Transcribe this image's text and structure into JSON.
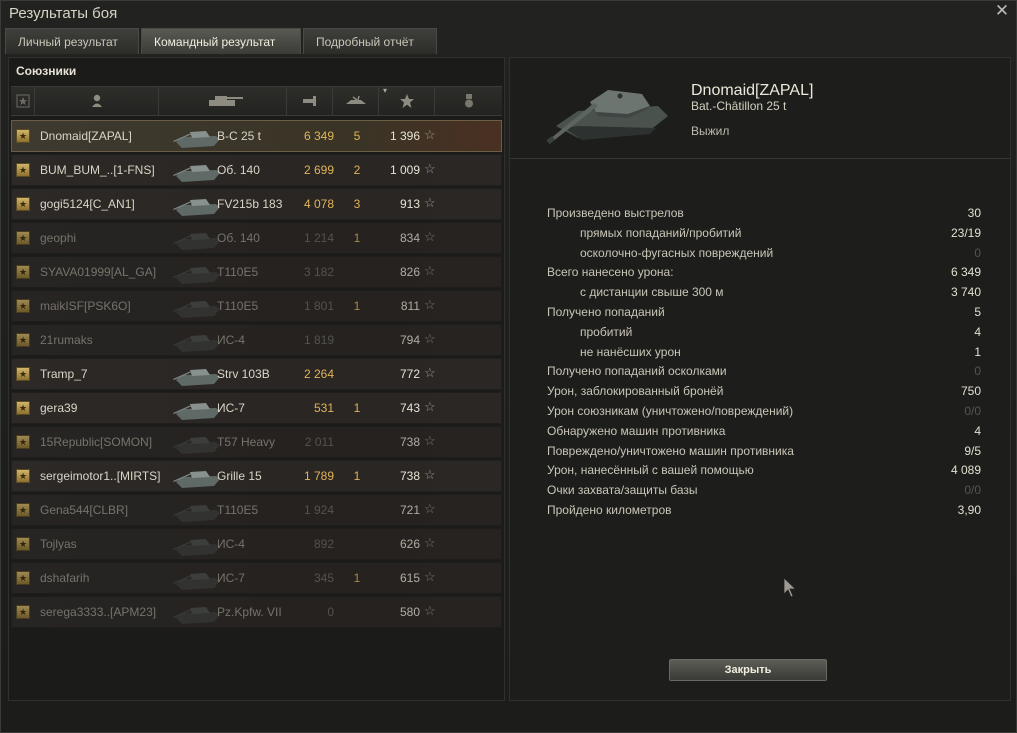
{
  "window": {
    "title": "Результаты боя"
  },
  "tabs": [
    {
      "label": "Личный результат"
    },
    {
      "label": "Командный результат"
    },
    {
      "label": "Подробный отчёт"
    }
  ],
  "allies": {
    "title": "Союзники",
    "rows": [
      {
        "player": "Dnomaid[ZAPAL]",
        "tank": "B-C 25 t",
        "damage": "6 349",
        "kills": "5",
        "xp": "1 396",
        "alive": true,
        "me": true
      },
      {
        "player": "BUM_BUM_..[1-FNS]",
        "tank": "Об. 140",
        "damage": "2 699",
        "kills": "2",
        "xp": "1 009",
        "alive": true
      },
      {
        "player": "gogi5124[C_AN1]",
        "tank": "FV215b 183",
        "damage": "4 078",
        "kills": "3",
        "xp": "913",
        "alive": true
      },
      {
        "player": "geophi",
        "tank": "Об. 140",
        "damage": "1 214",
        "kills": "1",
        "xp": "834",
        "alive": false
      },
      {
        "player": "SYAVA01999[AL_GA]",
        "tank": "T110E5",
        "damage": "3 182",
        "kills": "",
        "xp": "826",
        "alive": false
      },
      {
        "player": "maikISF[PSK6O]",
        "tank": "T110E5",
        "damage": "1 801",
        "kills": "1",
        "xp": "811",
        "alive": false
      },
      {
        "player": "21rumaks",
        "tank": "ИС-4",
        "damage": "1 819",
        "kills": "",
        "xp": "794",
        "alive": false
      },
      {
        "player": "Tramp_7",
        "tank": "Strv 103B",
        "damage": "2 264",
        "kills": "",
        "xp": "772",
        "alive": true
      },
      {
        "player": "gera39",
        "tank": "ИС-7",
        "damage": "531",
        "kills": "1",
        "xp": "743",
        "alive": true
      },
      {
        "player": "15Republic[SOMON]",
        "tank": "T57 Heavy",
        "damage": "2 011",
        "kills": "",
        "xp": "738",
        "alive": false
      },
      {
        "player": "sergeimotor1..[MIRTS]",
        "tank": "Grille 15",
        "damage": "1 789",
        "kills": "1",
        "xp": "738",
        "alive": true
      },
      {
        "player": "Gena544[CLBR]",
        "tank": "T110E5",
        "damage": "1 924",
        "kills": "",
        "xp": "721",
        "alive": false
      },
      {
        "player": "Tojlyas",
        "tank": "ИС-4",
        "damage": "892",
        "kills": "",
        "xp": "626",
        "alive": false
      },
      {
        "player": "dshafarih",
        "tank": "ИС-7",
        "damage": "345",
        "kills": "1",
        "xp": "615",
        "alive": false
      },
      {
        "player": "serega3333..[APM23]",
        "tank": "Pz.Kpfw. VII",
        "damage": "0",
        "kills": "",
        "xp": "580",
        "alive": false
      }
    ]
  },
  "detail": {
    "player": "Dnomaid[ZAPAL]",
    "tank": "Bat.-Châtillon 25 t",
    "status": "Выжил",
    "stats": [
      {
        "label": "Произведено выстрелов",
        "value": "30",
        "indent": false,
        "muted": false
      },
      {
        "label": "прямых попаданий/пробитий",
        "value": "23/19",
        "indent": true,
        "muted": false
      },
      {
        "label": "осколочно-фугасных повреждений",
        "value": "0",
        "indent": true,
        "muted": true
      },
      {
        "label": "Всего нанесено урона:",
        "value": "6 349",
        "indent": false,
        "muted": false
      },
      {
        "label": "с дистанции свыше 300 м",
        "value": "3 740",
        "indent": true,
        "muted": false
      },
      {
        "label": "Получено попаданий",
        "value": "5",
        "indent": false,
        "muted": false
      },
      {
        "label": "пробитий",
        "value": "4",
        "indent": true,
        "muted": false
      },
      {
        "label": "не нанёсших урон",
        "value": "1",
        "indent": true,
        "muted": false
      },
      {
        "label": "Получено попаданий осколками",
        "value": "0",
        "indent": false,
        "muted": true
      },
      {
        "label": "Урон, заблокированный бронёй",
        "value": "750",
        "indent": false,
        "muted": false
      },
      {
        "label": "Урон союзникам (уничтожено/повреждений)",
        "value": "0/0",
        "indent": false,
        "muted": true
      },
      {
        "label": "Обнаружено машин противника",
        "value": "4",
        "indent": false,
        "muted": false
      },
      {
        "label": "Повреждено/уничтожено машин противника",
        "value": "9/5",
        "indent": false,
        "muted": false
      },
      {
        "label": "Урон, нанесённый с вашей помощью",
        "value": "4 089",
        "indent": false,
        "muted": false
      },
      {
        "label": "Очки захвата/защиты базы",
        "value": "0/0",
        "indent": false,
        "muted": true
      },
      {
        "label": "Пройдено километров",
        "value": "3,90",
        "indent": false,
        "muted": false
      }
    ],
    "close_label": "Закрыть"
  },
  "colors": {
    "damage": "#e0b359",
    "accent_row": "#4a3022",
    "badge": "#c9a85a"
  }
}
